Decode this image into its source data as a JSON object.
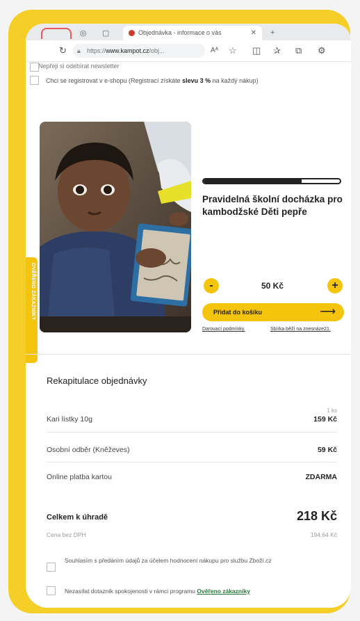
{
  "browser": {
    "active_tab_title": "Objednávka - informace o vás",
    "url_prefix": "https://",
    "url_domain": "www.kampot.cz",
    "url_suffix": "/obj...",
    "reader_label": "Aᴬ"
  },
  "form": {
    "cut_off_text": "Nepřeji si odebírat newsletter",
    "register_prefix": "Chci se registrovat v e-shopu (Registrací získáte ",
    "register_bold": "slevu 3 %",
    "register_suffix": " na každý nákup)"
  },
  "donation": {
    "progress_fraction": 0.72,
    "title": "Pravidelná školní docházka pro kambodžské Děti pepře",
    "minus_label": "-",
    "plus_label": "+",
    "amount": "50 Kč",
    "add_to_cart": "Přidat do košíku",
    "terms_link": "Darovací podmínky.",
    "collection_link": "Sbírka běží na znesnáze21."
  },
  "side_badge": {
    "label": "OVĚŘENO ZÁKAZNÍKY"
  },
  "summary": {
    "title": "Rekapitulace objednávky",
    "items": [
      {
        "label": "Kari lístky 10g",
        "qty": "1 ks",
        "price": "159 Kč"
      },
      {
        "label": "Osobní odběr (Kněževes)",
        "qty": "",
        "price": "59 Kč"
      },
      {
        "label": "Online platba kartou",
        "qty": "",
        "price": "ZDARMA"
      }
    ],
    "total_label": "Celkem k úhradě",
    "total_price": "218 Kč",
    "net_label": "Cena bez DPH",
    "net_price": "194,64 Kč"
  },
  "consents": {
    "zbozi_text": "Souhlasím s předáním údajů za účelem hodnocení nákupu pro službu Zboží.cz",
    "survey_text": "Nezasílat dotazník spokojenosti v rámci programu ",
    "survey_link": "Ověřeno zákazníky"
  },
  "colors": {
    "frame_yellow": "#f5cf28",
    "accent_yellow": "#f5c40d",
    "link_green": "#2a7a3a"
  }
}
